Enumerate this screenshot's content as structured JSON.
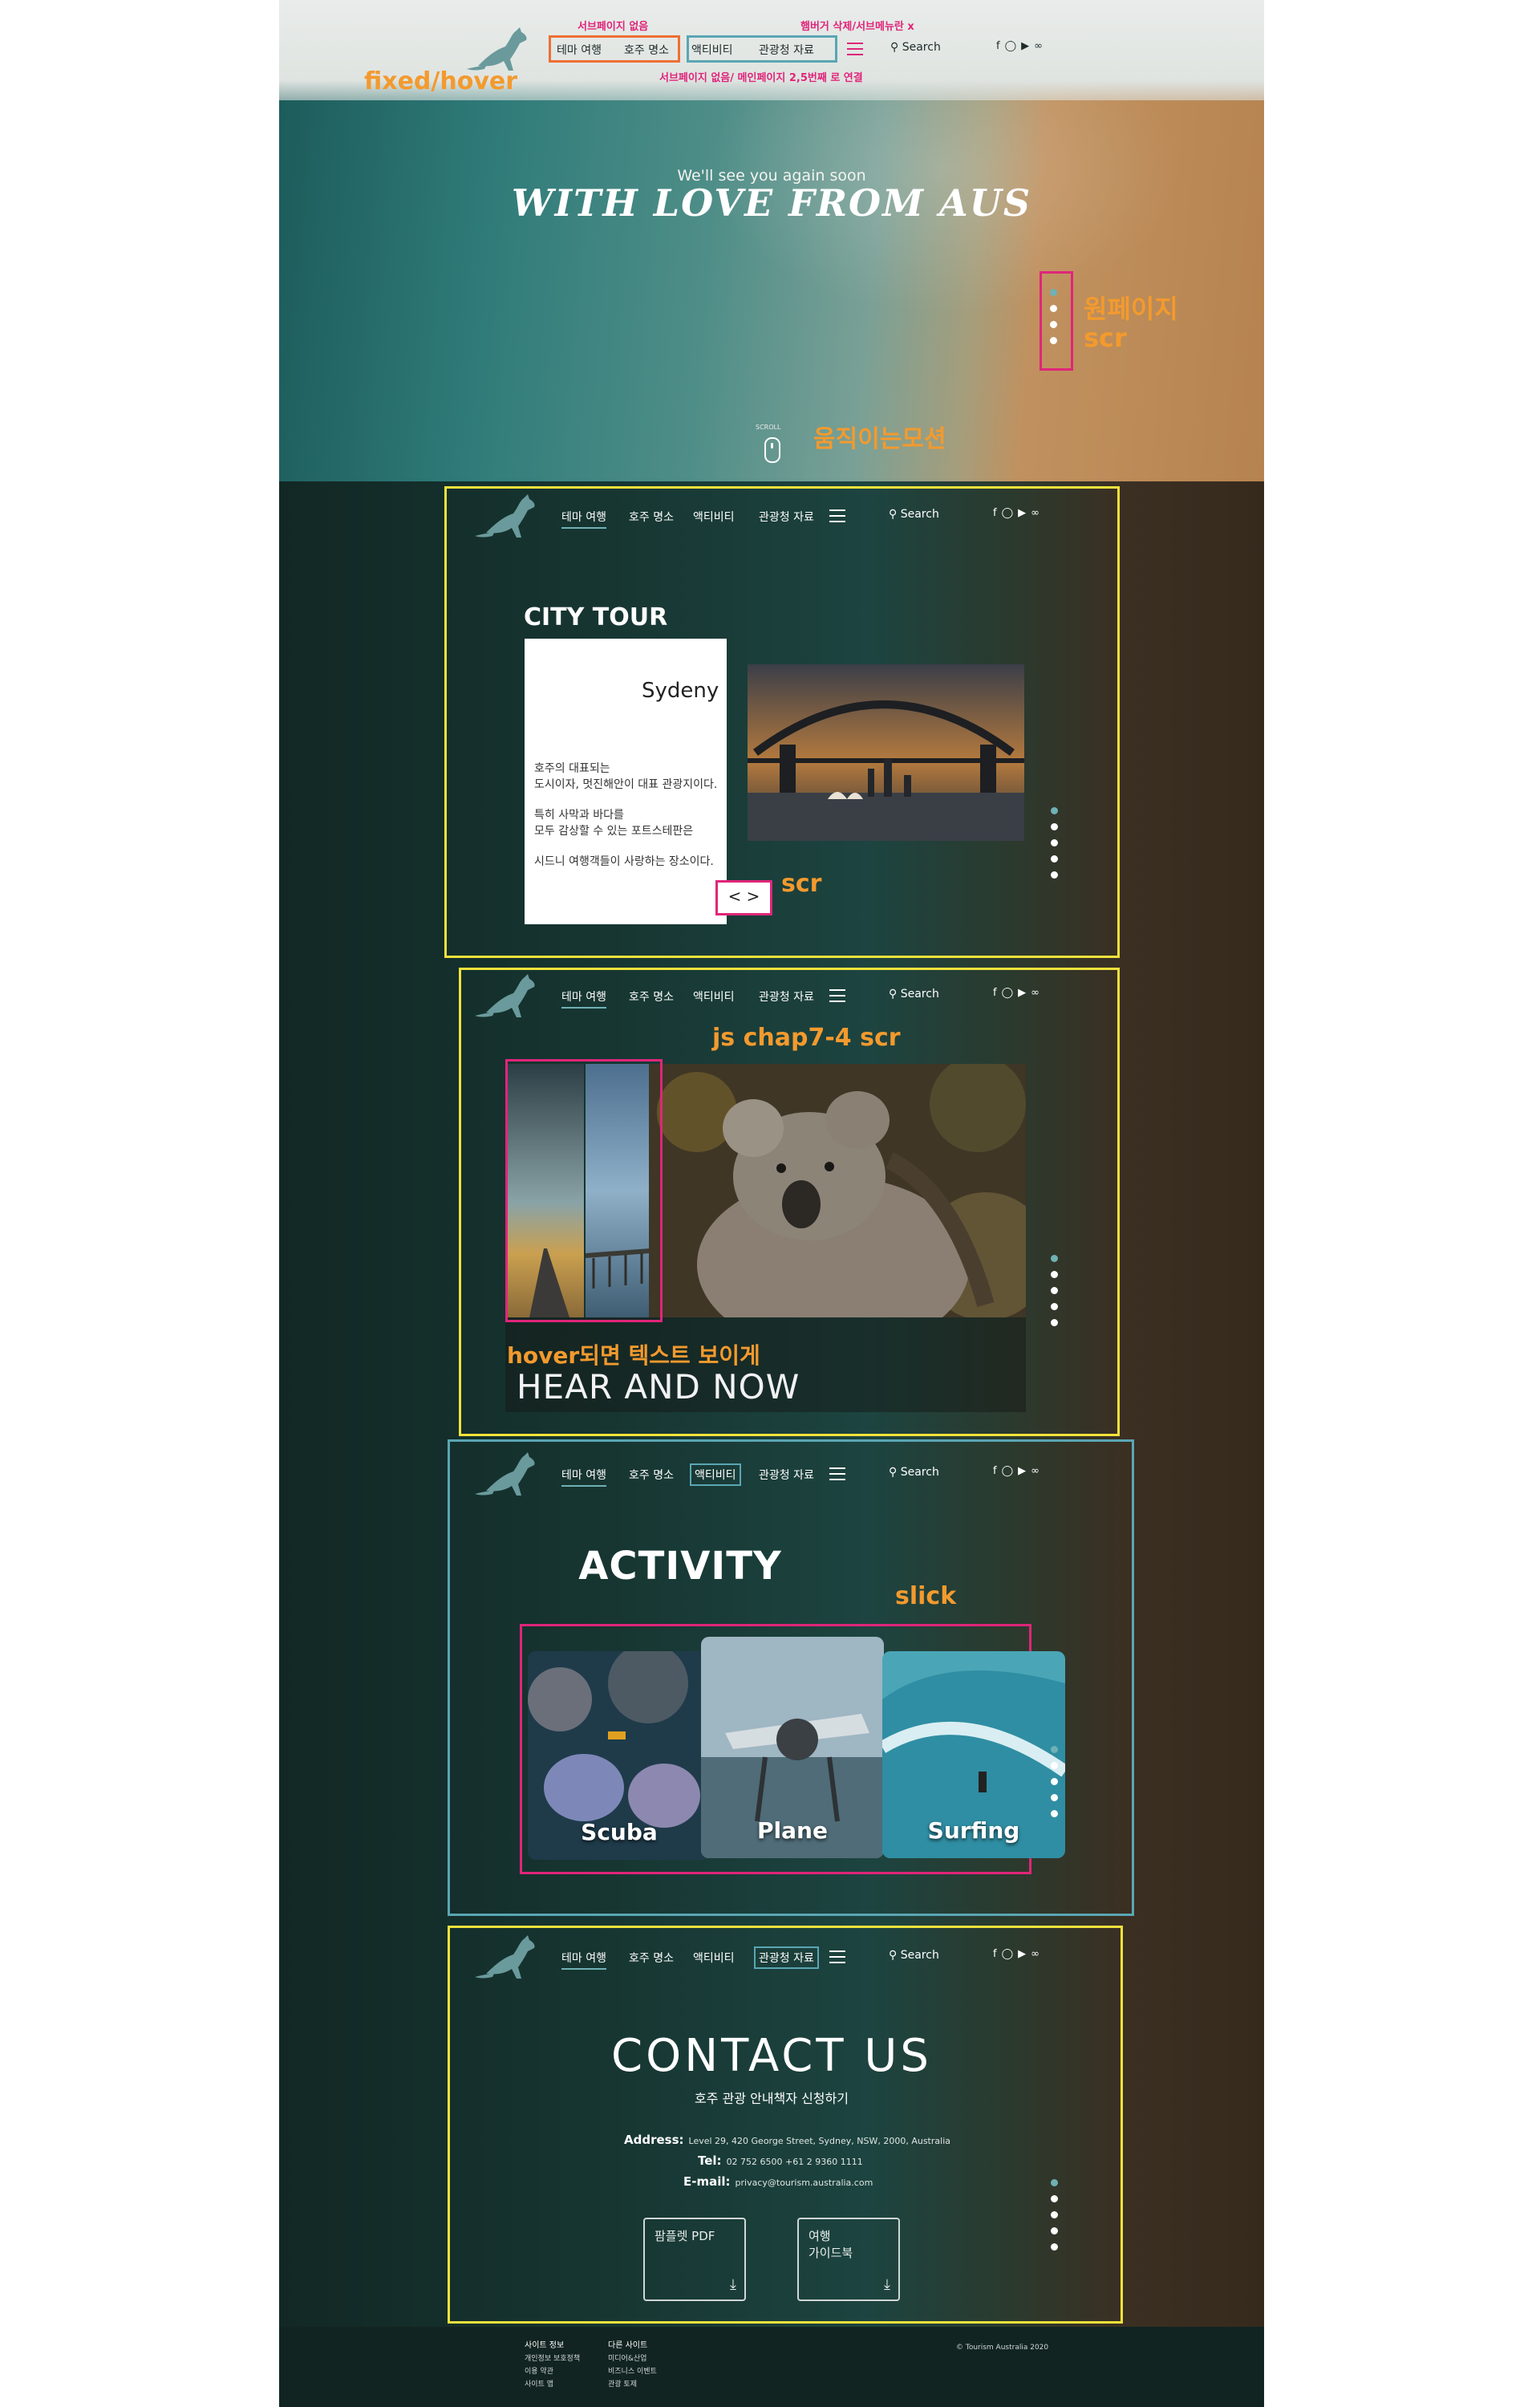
{
  "colors": {
    "accent": "#6fb1b5",
    "annotation_orange": "#f39a2e",
    "annotation_pink": "#e0257a",
    "box_yellow": "#f1e23b",
    "box_teal": "#5aa6b4"
  },
  "nav": {
    "items": [
      "테마 여행",
      "호주 명소",
      "액티비티",
      "관광청 자료"
    ],
    "search_label": "Search",
    "social_icons": [
      "facebook-icon",
      "instagram-icon",
      "youtube-icon",
      "tripadvisor-icon"
    ]
  },
  "annotations": {
    "fixed_hover": "fixed/hover",
    "no_subpage": "서브페이지 없음",
    "hamburger_note": "햄버거 삭제/서브메뉴란 x",
    "subpage_note": "서브페이지 없음/ 메인페이지 2,5번째 로 연결",
    "onepage": "원페이지",
    "scr": "scr",
    "moving_motion": "움직이는모션",
    "js_chap": "js chap7-4 scr",
    "hover_text": "hover되면 텍스트 보이게",
    "slick": "slick"
  },
  "hero": {
    "subtitle": "We'll see you again soon",
    "title": "WITH LOVE FROM AUS",
    "scroll_label": "SCROLL"
  },
  "city_tour": {
    "heading": "CITY TOUR",
    "city": "Sydeny",
    "lines": [
      "호주의 대표되는",
      "도시이자, 멋진해안이 대표 관광지이다.",
      "특히 사막과 바다를",
      "모두 감상할 수 있는 포트스테판은",
      "시드니 여행객들이 사랑하는 장소이다."
    ],
    "arrows": "< >"
  },
  "hear": {
    "title": "HEAR AND NOW"
  },
  "activity": {
    "heading": "ACTIVITY",
    "slides": [
      "Scuba",
      "Plane",
      "Surfing"
    ]
  },
  "contact": {
    "heading": "CONTACT US",
    "subtitle": "호주 관광 안내책자 신청하기",
    "address_label": "Address:",
    "address": "Level 29, 420 George Street, Sydney, NSW, 2000, Australia",
    "tel_label": "Tel:",
    "tel": "02 752 6500  +61 2 9360 1111",
    "email_label": "E-mail:",
    "email": "privacy@tourism.australia.com",
    "download1": "팜플렛 PDF",
    "download2": "여행\n가이드북"
  },
  "footer": {
    "col1_head": "사이트 정보",
    "col1": [
      "개인정보 보호정책",
      "이용 약관",
      "사이트 맵"
    ],
    "col2_head": "다른 사이트",
    "col2": [
      "미디어&산업",
      "비즈니스 이벤트",
      "관광 토제"
    ],
    "copyright": "© Tourism Australia 2020"
  }
}
